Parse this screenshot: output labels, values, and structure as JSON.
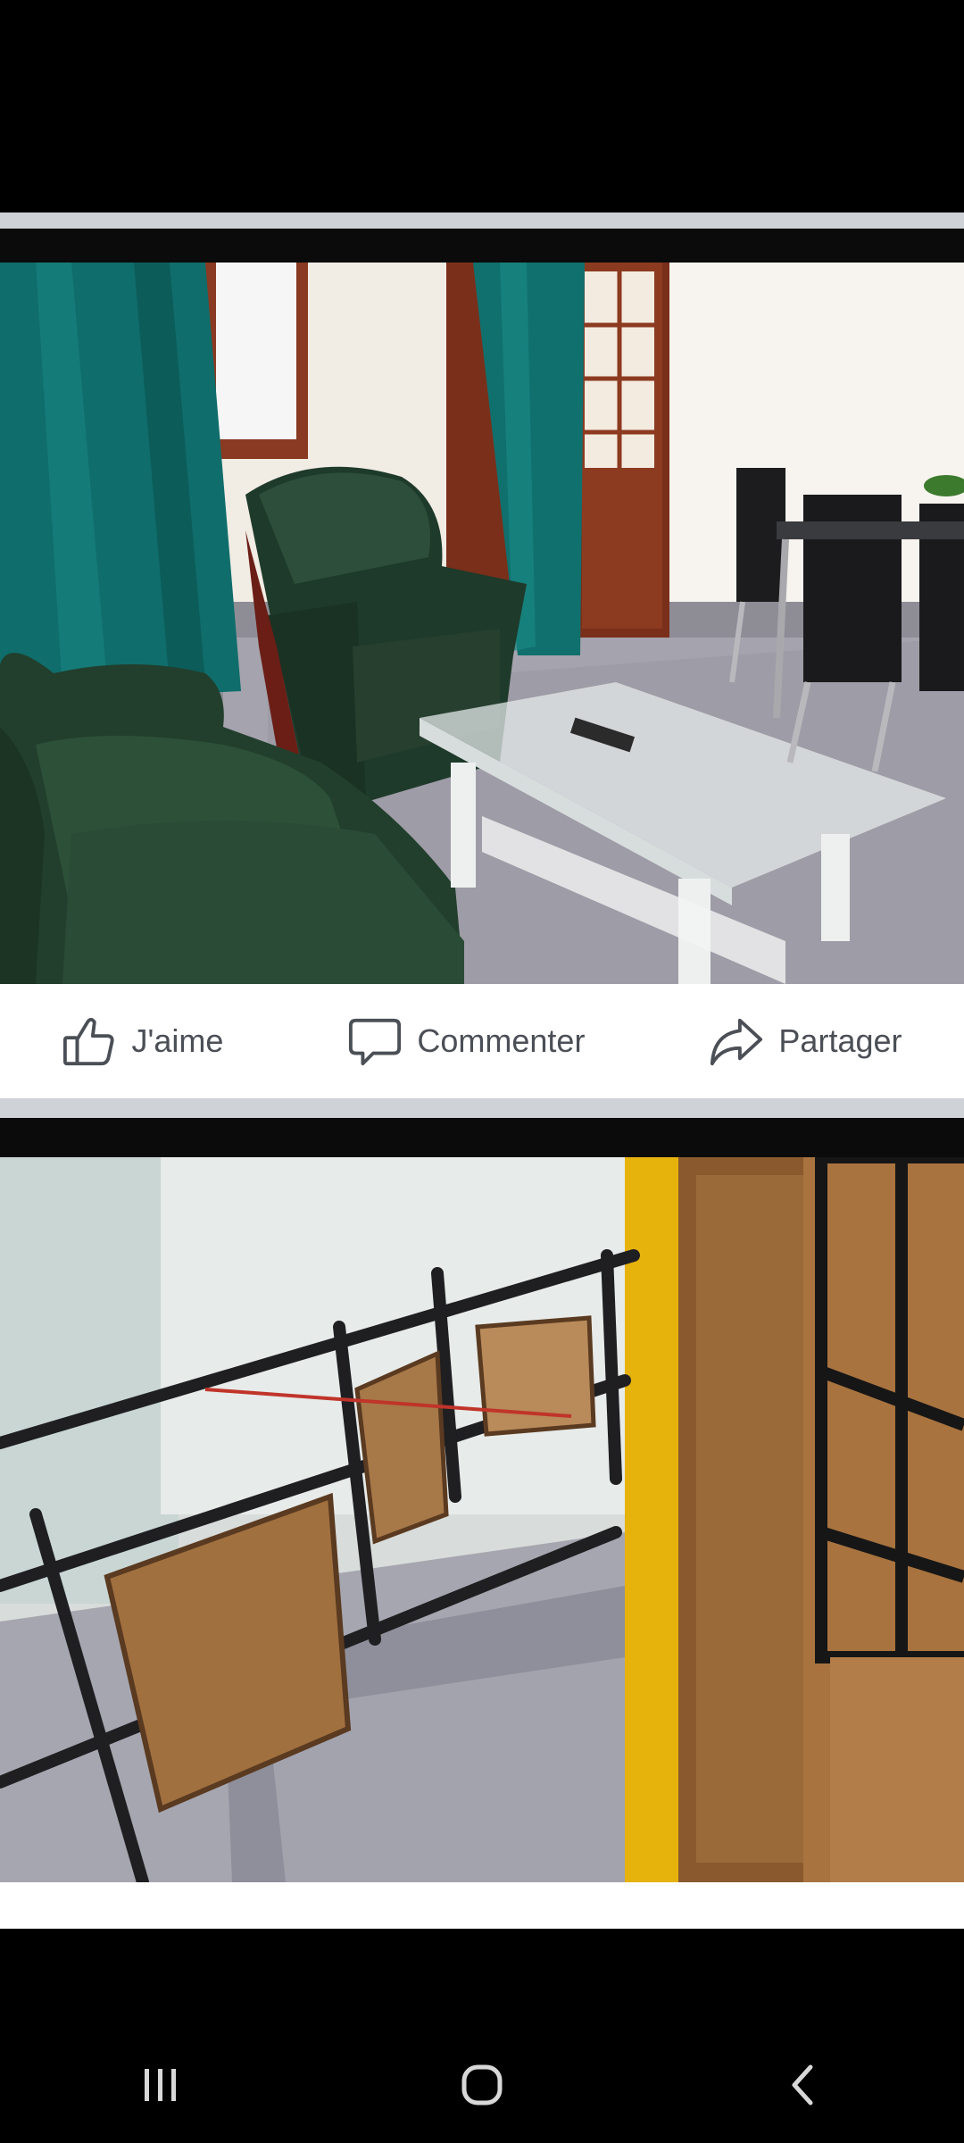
{
  "post_actions": {
    "like_label": "J'aime",
    "comment_label": "Commenter",
    "share_label": "Partager",
    "like_icon": "thumbs-up-icon",
    "comment_icon": "speech-bubble-icon",
    "share_icon": "share-arrow-icon"
  },
  "nav_bar": {
    "recents_icon": "recent-apps-icon",
    "home_icon": "home-icon",
    "back_icon": "back-icon"
  },
  "colors": {
    "action_text": "#4b4f56",
    "separator": "#cfd2d6",
    "background": "#000000"
  }
}
